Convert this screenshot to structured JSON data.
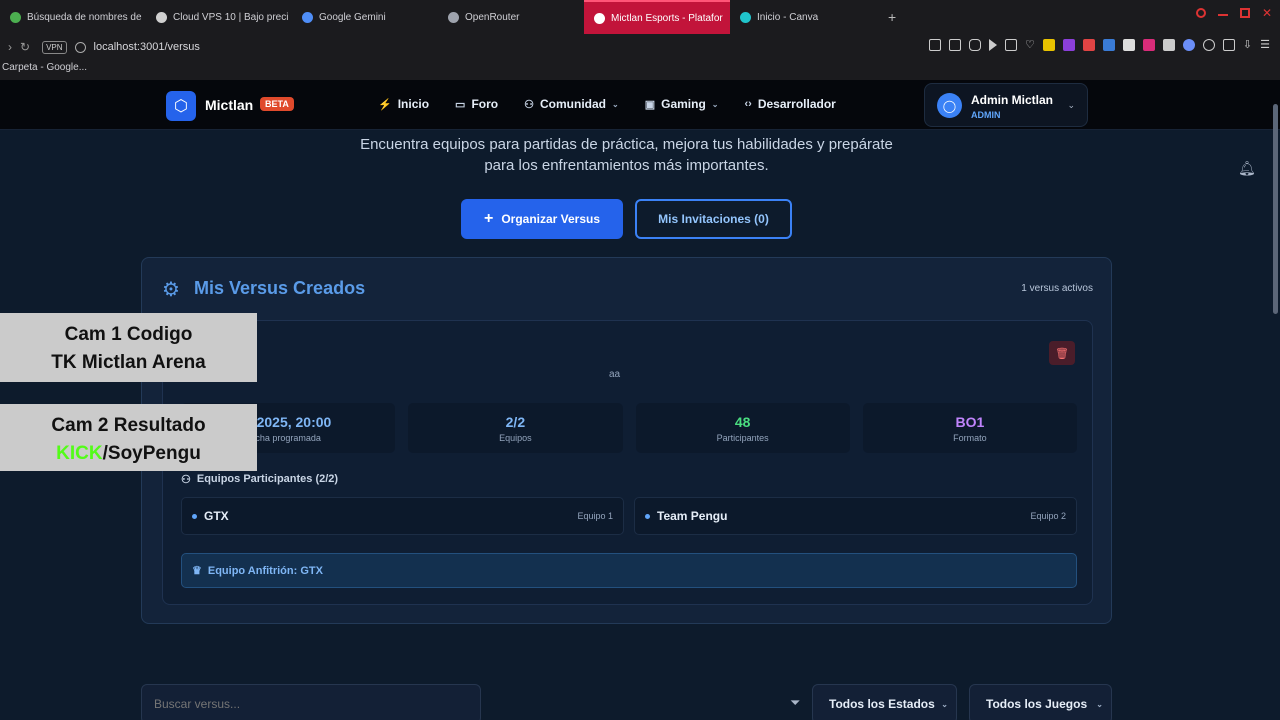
{
  "browser": {
    "tabs": [
      {
        "label": "Búsqueda de nombres de",
        "color": "#4caf50"
      },
      {
        "label": "Cloud VPS 10 | Bajo preci",
        "color": "#d0d0d0"
      },
      {
        "label": "Google Gemini",
        "color": "#4f8ef7"
      },
      {
        "label": "OpenRouter",
        "color": "#9ea3ad"
      },
      {
        "label": "Mictlan Esports - Platafor",
        "color": "#ffffff"
      },
      {
        "label": "Inicio - Canva",
        "color": "#20c4cb"
      }
    ],
    "new_tab": "+",
    "vpn": "VPN",
    "url": "localhost:3001/versus",
    "bookmark": "Carpeta - Google..."
  },
  "header": {
    "brand": "Mictlan",
    "beta": "BETA",
    "nav": [
      {
        "label": "Inicio",
        "icon": "⚡"
      },
      {
        "label": "Foro",
        "icon": "☐"
      },
      {
        "label": "Comunidad",
        "icon": "👥",
        "dropdown": true
      },
      {
        "label": "Gaming",
        "icon": "🎮",
        "dropdown": true
      },
      {
        "label": "Desarrollador",
        "icon": "<>"
      }
    ],
    "user": {
      "name": "Admin Mictlan",
      "role": "ADMIN"
    }
  },
  "hero": {
    "line1": "Encuentra equipos para partidas de práctica, mejora tus habilidades y prepárate",
    "line2": "para los enfrentamientos más importantes."
  },
  "actions": {
    "organize": "Organizar Versus",
    "invitations": "Mis Invitaciones (0)"
  },
  "panel": {
    "title": "Mis Versus Creados",
    "active_count": "1 versus activos",
    "card": {
      "description": "aa",
      "stats": [
        {
          "value": "3/2025, 20:00",
          "label": "cha programada"
        },
        {
          "value": "2/2",
          "label": "Equipos"
        },
        {
          "value": "48",
          "label": "Participantes"
        },
        {
          "value": "BO1",
          "label": "Formato"
        }
      ],
      "teams_header": "Equipos Participantes (2/2)",
      "teams": [
        {
          "name": "GTX",
          "tag": "Equipo 1"
        },
        {
          "name": "Team Pengu",
          "tag": "Equipo 2"
        }
      ],
      "host": "Equipo Anfitrión: GTX"
    }
  },
  "filters": {
    "search_placeholder": "Buscar versus...",
    "status": "Todos los Estados",
    "games": "Todos los Juegos"
  },
  "overlays": {
    "cam1_line1": "Cam 1 Codigo",
    "cam1_line2": "TK Mictlan Arena",
    "cam2_line1": "Cam 2 Resultado",
    "cam2_kick": "KICK",
    "cam2_rest": "/SoyPengu"
  }
}
